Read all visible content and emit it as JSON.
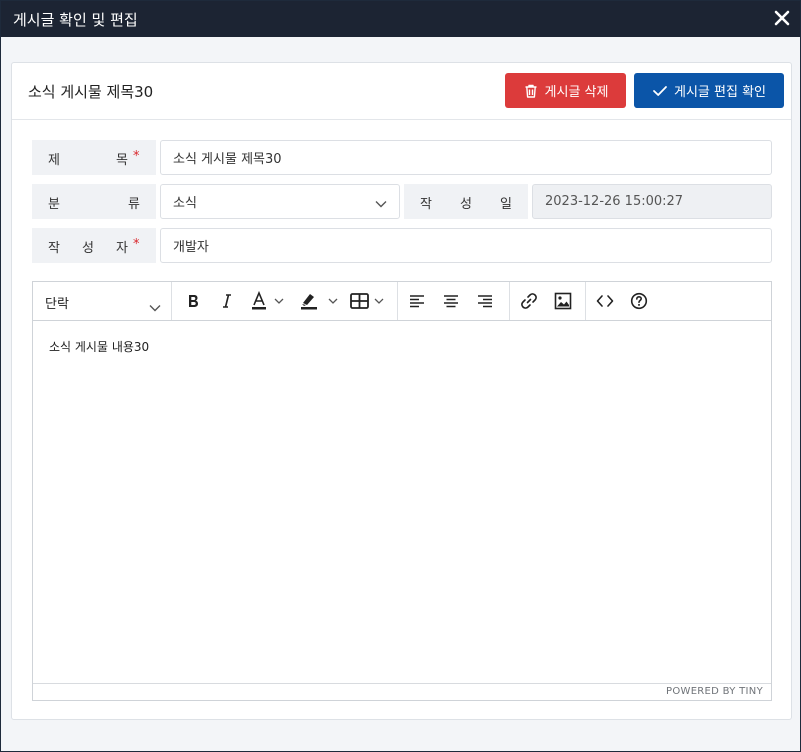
{
  "window": {
    "title": "게시글 확인 및 편집"
  },
  "card": {
    "title": "소식 게시물 제목30",
    "delete_label": "게시글 삭제",
    "confirm_label": "게시글 편집 확인"
  },
  "form": {
    "title_label": [
      "제",
      "목"
    ],
    "title_value": "소식 게시물 제목30",
    "category_label": [
      "분",
      "류"
    ],
    "category_value": "소식",
    "date_label": [
      "작",
      "성",
      "일"
    ],
    "date_value": "2023-12-26 15:00:27",
    "author_label": [
      "작",
      "성",
      "자"
    ],
    "author_value": "개발자",
    "required_mark": "*"
  },
  "editor": {
    "block_format": "단락",
    "content": "소식 게시물 내용30",
    "powered": "POWERED BY TINY"
  },
  "colors": {
    "danger": "#dc3b3b",
    "primary": "#0b55a8",
    "titlebar": "#1c2433"
  }
}
